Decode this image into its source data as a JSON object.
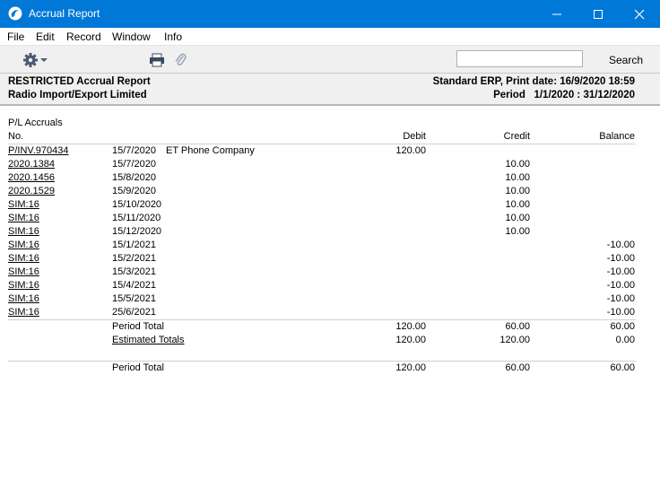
{
  "window": {
    "title": "Accrual Report"
  },
  "menu": [
    "File",
    "Edit",
    "Record",
    "Window",
    "Info"
  ],
  "toolbar": {
    "search_placeholder": "",
    "search_label": "Search"
  },
  "header": {
    "title": "RESTRICTED Accrual Report",
    "company": "Radio Import/Export Limited",
    "system": "Standard ERP, Print date: 16/9/2020 18:59",
    "period_label": "Period",
    "period_value": "1/1/2020 : 31/12/2020"
  },
  "report": {
    "section": "P/L Accruals",
    "columns": {
      "no": "No.",
      "debit": "Debit",
      "credit": "Credit",
      "balance": "Balance"
    },
    "rows": [
      {
        "no": "P/INV.970434",
        "date": "15/7/2020",
        "desc": "ET Phone Company",
        "debit": "120.00",
        "credit": "",
        "balance": ""
      },
      {
        "no": "2020.1384",
        "date": "15/7/2020",
        "desc": "",
        "debit": "",
        "credit": "10.00",
        "balance": ""
      },
      {
        "no": "2020.1456",
        "date": "15/8/2020",
        "desc": "",
        "debit": "",
        "credit": "10.00",
        "balance": ""
      },
      {
        "no": "2020.1529",
        "date": "15/9/2020",
        "desc": "",
        "debit": "",
        "credit": "10.00",
        "balance": ""
      },
      {
        "no": "SIM:16",
        "date": "15/10/2020",
        "desc": "",
        "debit": "",
        "credit": "10.00",
        "balance": ""
      },
      {
        "no": "SIM:16",
        "date": "15/11/2020",
        "desc": "",
        "debit": "",
        "credit": "10.00",
        "balance": ""
      },
      {
        "no": "SIM:16",
        "date": "15/12/2020",
        "desc": "",
        "debit": "",
        "credit": "10.00",
        "balance": ""
      },
      {
        "no": "SIM:16",
        "date": "15/1/2021",
        "desc": "",
        "debit": "",
        "credit": "",
        "balance": "-10.00"
      },
      {
        "no": "SIM:16",
        "date": "15/2/2021",
        "desc": "",
        "debit": "",
        "credit": "",
        "balance": "-10.00"
      },
      {
        "no": "SIM:16",
        "date": "15/3/2021",
        "desc": "",
        "debit": "",
        "credit": "",
        "balance": "-10.00"
      },
      {
        "no": "SIM:16",
        "date": "15/4/2021",
        "desc": "",
        "debit": "",
        "credit": "",
        "balance": "-10.00"
      },
      {
        "no": "SIM:16",
        "date": "15/5/2021",
        "desc": "",
        "debit": "",
        "credit": "",
        "balance": "-10.00"
      },
      {
        "no": "SIM:16",
        "date": "25/6/2021",
        "desc": "",
        "debit": "",
        "credit": "",
        "balance": "-10.00"
      }
    ],
    "period_total": {
      "label": "Period Total",
      "debit": "120.00",
      "credit": "60.00",
      "balance": "60.00"
    },
    "estimated_totals": {
      "label": "Estimated Totals",
      "debit": "120.00",
      "credit": "120.00",
      "balance": "0.00"
    },
    "grand_total": {
      "label": "Period Total",
      "debit": "120.00",
      "credit": "60.00",
      "balance": "60.00"
    }
  },
  "icons": {
    "app": "app-logo-icon",
    "minimize": "minimize-icon",
    "maximize": "maximize-icon",
    "close": "close-icon",
    "settings": "gear-icon",
    "print": "printer-icon",
    "attach": "paperclip-icon"
  },
  "colors": {
    "titlebar": "#0078d7",
    "toolbar": "#f0f0f0"
  }
}
